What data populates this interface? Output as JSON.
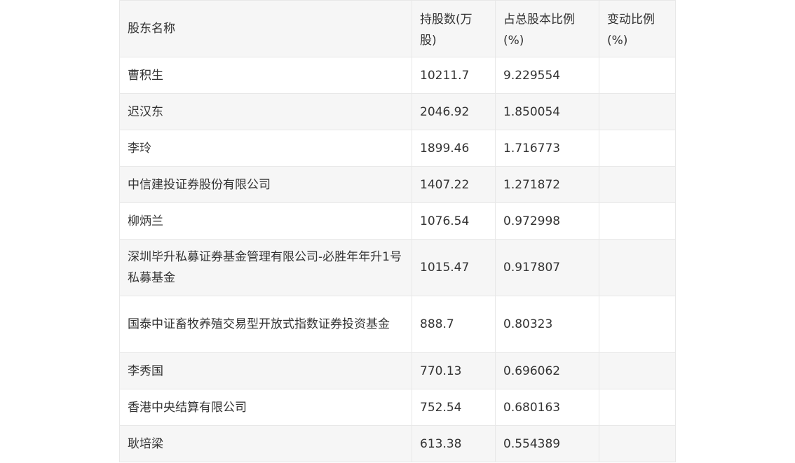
{
  "table": {
    "headers": [
      "股东名称",
      "持股数(万股)",
      "占总股本比例(%)",
      "变动比例(%)"
    ],
    "rows": [
      {
        "name": "曹积生",
        "shares": "10211.7",
        "ratio": "9.229554",
        "change": ""
      },
      {
        "name": "迟汉东",
        "shares": "2046.92",
        "ratio": "1.850054",
        "change": ""
      },
      {
        "name": "李玲",
        "shares": "1899.46",
        "ratio": "1.716773",
        "change": ""
      },
      {
        "name": "中信建投证券股份有限公司",
        "shares": "1407.22",
        "ratio": "1.271872",
        "change": ""
      },
      {
        "name": "柳炳兰",
        "shares": "1076.54",
        "ratio": "0.972998",
        "change": ""
      },
      {
        "name": "深圳毕升私募证券基金管理有限公司-必胜年年升1号私募基金",
        "shares": "1015.47",
        "ratio": "0.917807",
        "change": ""
      },
      {
        "name": "国泰中证畜牧养殖交易型开放式指数证券投资基金",
        "shares": "888.7",
        "ratio": "0.80323",
        "change": ""
      },
      {
        "name": "李秀国",
        "shares": "770.13",
        "ratio": "0.696062",
        "change": ""
      },
      {
        "name": "香港中央结算有限公司",
        "shares": "752.54",
        "ratio": "0.680163",
        "change": ""
      },
      {
        "name": "耿培梁",
        "shares": "613.38",
        "ratio": "0.554389",
        "change": ""
      }
    ]
  }
}
